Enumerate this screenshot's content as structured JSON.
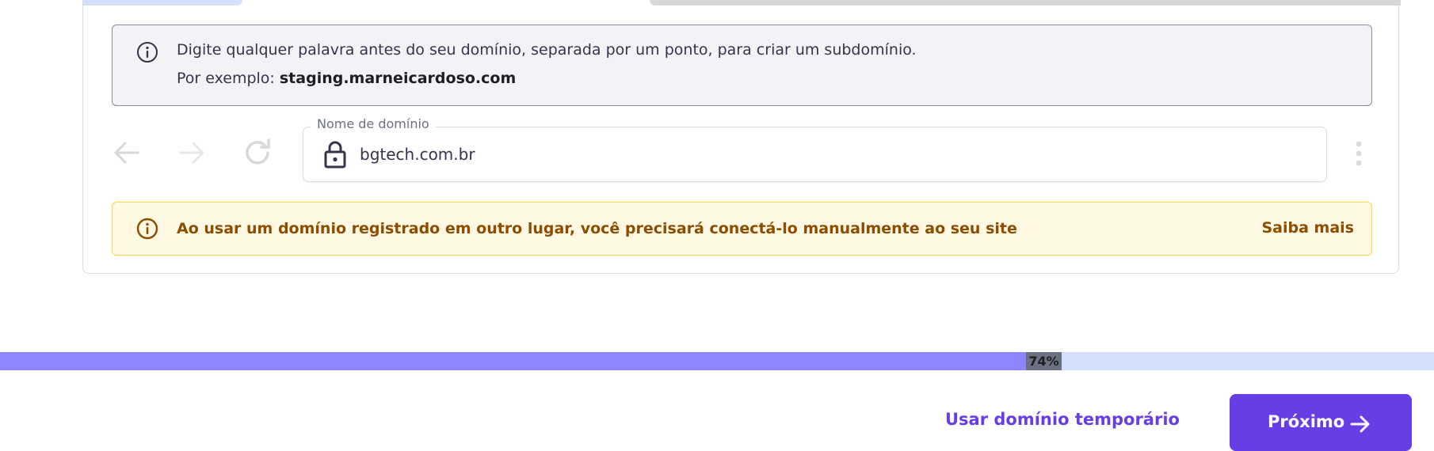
{
  "info": {
    "line1": "Digite qualquer palavra antes do seu domínio, separada por um ponto, para criar um subdomínio.",
    "example_prefix": "Por exemplo: ",
    "example_value": "staging.marneicardoso.com",
    "icon": "info-icon"
  },
  "domain_field": {
    "label": "Nome de domínio",
    "value": "bgtech.com.br",
    "icon": "lock-icon"
  },
  "browser_nav": {
    "back_icon": "arrow-left-icon",
    "forward_icon": "arrow-right-icon",
    "reload_icon": "reload-icon",
    "menu_icon": "kebab-menu-icon"
  },
  "warning": {
    "text": "Ao usar um domínio registrado em outro lugar, você precisará conectá-lo manualmente ao seu site",
    "link": "Saiba mais",
    "icon": "info-icon"
  },
  "progress": {
    "value": 0.74,
    "label": "74%"
  },
  "footer": {
    "temp_domain_label": "Usar domínio temporário",
    "next_label": "Próximo",
    "next_icon": "arrow-right-icon"
  },
  "colors": {
    "primary": "#673de6",
    "warning_text": "#8c4d00",
    "warning_bg": "#fff8e2",
    "progress_fill": "#8c85ff",
    "progress_track": "#d5dfff"
  }
}
